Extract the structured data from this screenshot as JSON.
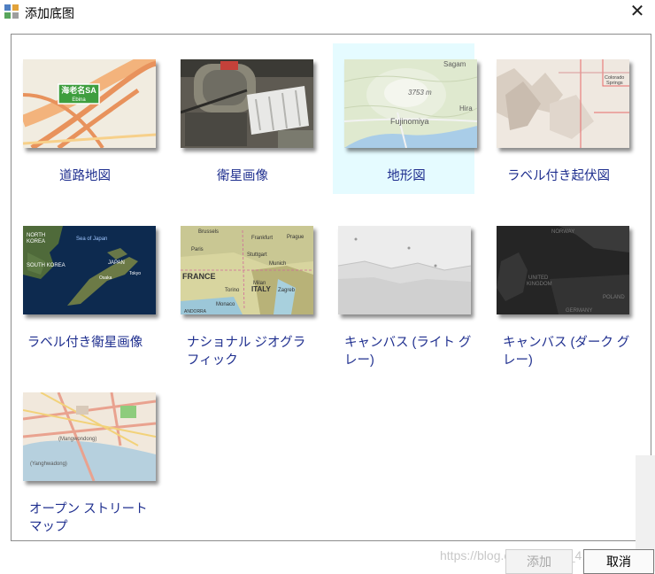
{
  "window": {
    "title": "添加底图"
  },
  "basemaps": [
    {
      "label": "道路地図"
    },
    {
      "label": "衛星画像"
    },
    {
      "label": "地形図"
    },
    {
      "label": "ラベル付き起伏図"
    },
    {
      "label": "ラベル付き衛星画像"
    },
    {
      "label": "ナショナル ジオグラフィック"
    },
    {
      "label": "キャンバス (ライト グレー)"
    },
    {
      "label": "キャンバス (ダーク グレー)"
    },
    {
      "label": "オープン ストリート マップ"
    }
  ],
  "thumbs": {
    "road": {
      "sign_line1": "海老名SA",
      "sign_line2": "Ebina"
    },
    "topo": {
      "peak": "3753 m",
      "city": "Fujinomiya",
      "top": "Sagam",
      "right": "Hira"
    },
    "relief": {
      "text1": "Colorado",
      "text2": "Springs"
    },
    "sat_labels": {
      "t1": "NORTH",
      "t2": "KOREA",
      "t3": "Sea of Japan",
      "t4": "SOUTH KOREA",
      "t5": "JAPAN",
      "t6": "Osaka",
      "t7": "Tokyo"
    },
    "natgeo": {
      "t1": "Brussels",
      "t2": "Frankfurt",
      "t3": "Prague",
      "t4": "Paris",
      "t5": "Stuttgart",
      "t6": "Munich",
      "t7": "FRANCE",
      "t8": "Milan",
      "t9": "ITALY",
      "t10": "Zagreb",
      "t11": "Monaco",
      "t12": "Torino",
      "t13": "ANDORRA"
    },
    "dark": {
      "t1": "NORWAY",
      "t2": "UNITED",
      "t3": "KINGDOM",
      "t4": "POLAND",
      "t5": "GERMANY"
    },
    "osm": {
      "t1": "(Mangwondong)",
      "t2": "(Yanghwadong)"
    }
  },
  "buttons": {
    "add": "添加",
    "cancel": "取消"
  },
  "watermark": "https://blog.csdn.net/qq_4..."
}
